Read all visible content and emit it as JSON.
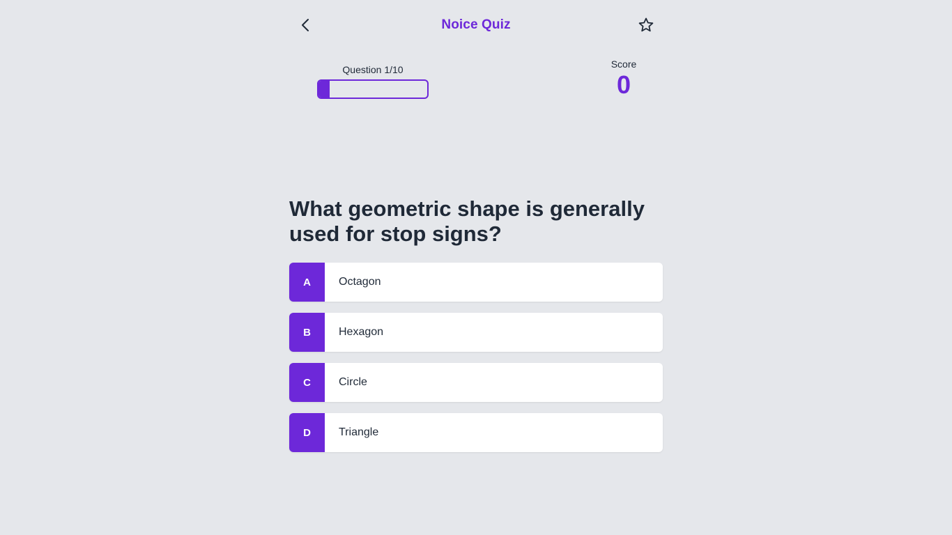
{
  "header": {
    "title": "Noice Quiz",
    "back_icon": "chevron-left-icon",
    "favorite_icon": "star-outline-icon"
  },
  "progress": {
    "label": "Question 1/10",
    "current": 1,
    "total": 10,
    "fraction": 0.1
  },
  "score": {
    "label": "Score",
    "value": "0"
  },
  "question": {
    "text": "What geometric shape is generally used for stop signs?"
  },
  "answers": [
    {
      "letter": "A",
      "text": "Octagon"
    },
    {
      "letter": "B",
      "text": "Hexagon"
    },
    {
      "letter": "C",
      "text": "Circle"
    },
    {
      "letter": "D",
      "text": "Triangle"
    }
  ],
  "colors": {
    "accent": "#6d28d9",
    "background": "#e5e7eb",
    "card": "#ffffff",
    "text": "#1f2937"
  }
}
